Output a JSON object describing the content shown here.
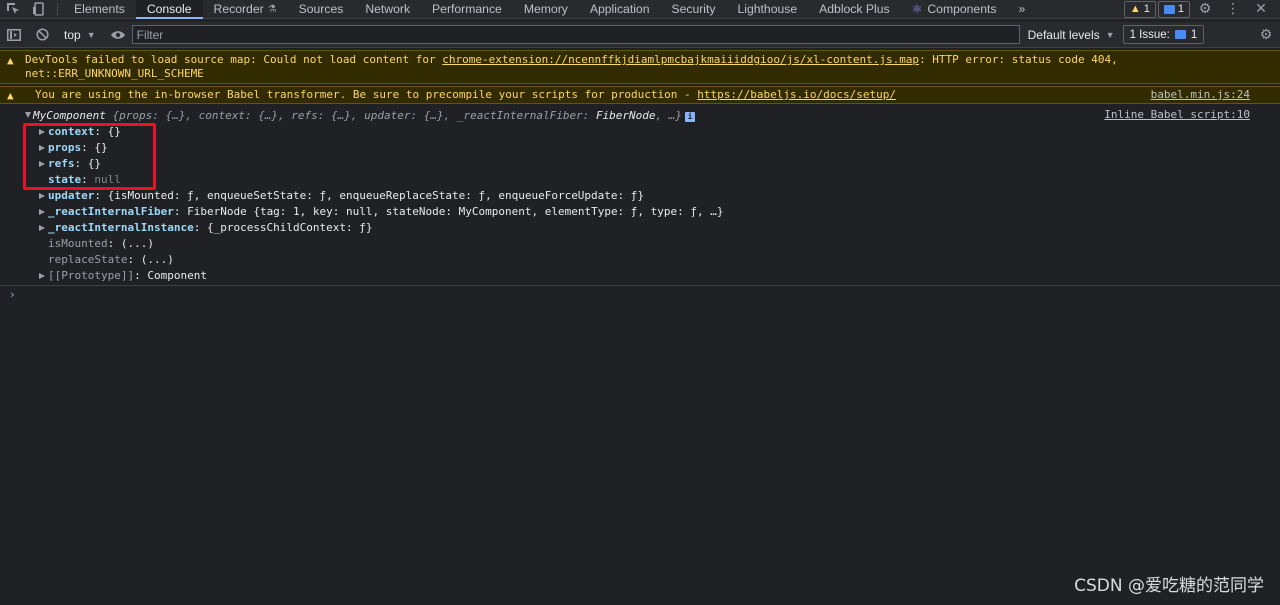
{
  "tabbar": {
    "tabs": [
      "Elements",
      "Console",
      "Recorder",
      "Sources",
      "Network",
      "Performance",
      "Memory",
      "Application",
      "Security",
      "Lighthouse",
      "Adblock Plus",
      "Components"
    ],
    "more": "»",
    "warnings_count": "1",
    "messages_count": "1"
  },
  "toolbar": {
    "context": "top",
    "filter_placeholder": "Filter",
    "levels": "Default levels",
    "issues": "1 Issue:",
    "issues_count": "1"
  },
  "messages": {
    "warning1": {
      "line1_prefix": "DevTools failed to load source map: Could not load content for ",
      "line1_link": "chrome-extension://ncennffkjdiamlpmcbajkmaiiiddgioo/js/xl-content.js.map",
      "line1_suffix": ": HTTP error: status code 404,",
      "line2": "net::ERR_UNKNOWN_URL_SCHEME"
    },
    "warning2": {
      "prefix": "You are using the in-browser Babel transformer. Be sure to precompile your scripts for production - ",
      "link": "https://babeljs.io/docs/setup/",
      "source": "babel.min.js:24"
    },
    "log": {
      "source": "Inline Babel script:10",
      "summary_name": "MyComponent",
      "summary_rest": " {props: {…}, context: {…}, refs: {…}, updater: {…}, _reactInternalFiber: ",
      "summary_fiber": "FiberNode",
      "summary_end": ", …}",
      "props": [
        {
          "key": "context",
          "value": "{}"
        },
        {
          "key": "props",
          "value": "{}"
        },
        {
          "key": "refs",
          "value": "{}"
        },
        {
          "key": "state",
          "value": "null"
        },
        {
          "key": "updater",
          "value": "{isMounted: ƒ, enqueueSetState: ƒ, enqueueReplaceState: ƒ, enqueueForceUpdate: ƒ}"
        },
        {
          "key": "_reactInternalFiber",
          "value": "FiberNode {tag: 1, key: null, stateNode: MyComponent, elementType: ƒ, type: ƒ, …}"
        },
        {
          "key": "_reactInternalInstance",
          "value": "{_processChildContext: ƒ}"
        },
        {
          "key": "isMounted",
          "value": "(...)"
        },
        {
          "key": "replaceState",
          "value": "(...)"
        },
        {
          "key": "[[Prototype]]",
          "value": "Component"
        }
      ]
    }
  },
  "prompt": "›",
  "watermark": "CSDN @爱吃糖的范同学",
  "colors": {
    "background": "#202124",
    "warning_text": "#fdd663",
    "warning_bg": "#332b00",
    "key": "#9cd8f8",
    "highlight": "#e8122b"
  }
}
